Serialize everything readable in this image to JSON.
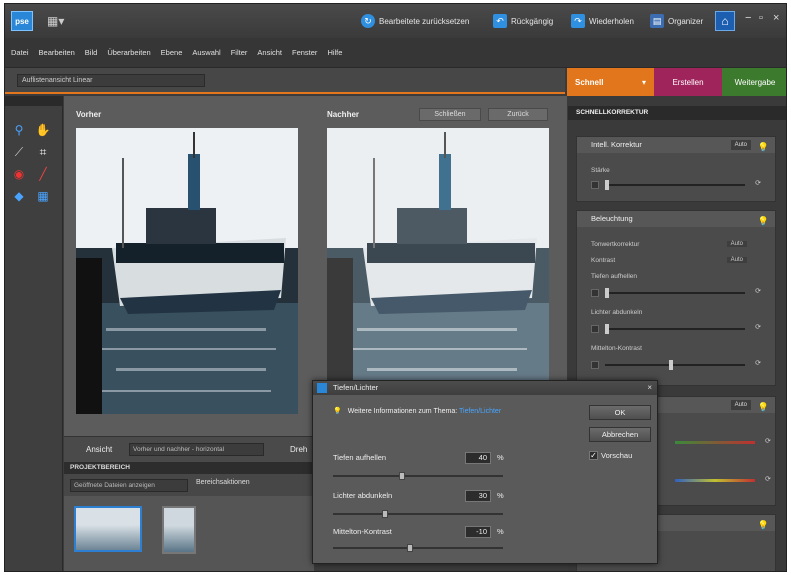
{
  "app": {
    "logo_text": "pse"
  },
  "titlebar": {
    "actions": [
      {
        "label": "Bearbeitete zurücksetzen",
        "icon": "refresh-icon"
      },
      {
        "label": "Rückgängig",
        "icon": "undo-icon"
      },
      {
        "label": "Wiederholen",
        "icon": "redo-icon"
      },
      {
        "label": "Organizer",
        "icon": "organizer-icon"
      }
    ]
  },
  "menu": [
    "Datei",
    "Bearbeiten",
    "Bild",
    "Überarbeiten",
    "Ebene",
    "Auswahl",
    "Filter",
    "Ansicht",
    "Fenster",
    "Hilfe"
  ],
  "options_bar": {
    "preset": "Auflistenansicht   Linear"
  },
  "mode_tabs": [
    {
      "label": "Schnell",
      "color": "#e2761c"
    },
    {
      "label": "Erstellen",
      "color": "#a0245c"
    },
    {
      "label": "Weitergabe",
      "color": "#3c7a2e"
    }
  ],
  "canvas": {
    "before_label": "Vorher",
    "after_label": "Nachher",
    "btn_a": "Schließen",
    "btn_b": "Zurück"
  },
  "viewbar": {
    "label": "Ansicht",
    "value": "Vorher und nachher - horizontal",
    "label2": "Dreh"
  },
  "project_bin": {
    "header": "PROJEKTBEREICH",
    "filter": "Geöffnete Dateien anzeigen",
    "action": "Bereichsaktionen"
  },
  "right_panel": {
    "header": "SCHNELLKORREKTUR",
    "sections": [
      {
        "title": "Intell. Korrektur",
        "auto": "Auto",
        "controls": [
          {
            "label": "Stärke",
            "value": 0.0
          }
        ]
      },
      {
        "title": "Beleuchtung",
        "rows": [
          {
            "label": "Tonwertkorrektur",
            "auto": "Auto"
          },
          {
            "label": "Kontrast",
            "auto": "Auto"
          }
        ],
        "controls": [
          {
            "label": "Tiefen aufhellen",
            "value": 0.0
          },
          {
            "label": "Lichter abdunkeln",
            "value": 0.0
          },
          {
            "label": "Mittelton-Kontrast",
            "value": 0.47
          }
        ]
      },
      {
        "title": "",
        "auto": "Auto"
      },
      {
        "title": ""
      }
    ]
  },
  "dialog": {
    "title": "Tiefen/Lichter",
    "info_text": "Weitere Informationen zum Thema: ",
    "info_link": "Tiefen/Lichter",
    "ok": "OK",
    "cancel": "Abbrechen",
    "preview": "Vorschau",
    "preview_checked": true,
    "fields": [
      {
        "label": "Tiefen aufhellen",
        "value": "40",
        "unit": "%",
        "level": 0.4
      },
      {
        "label": "Lichter abdunkeln",
        "value": "30",
        "unit": "%",
        "level": 0.3
      },
      {
        "label": "Mittelton-Kontrast",
        "value": "-10",
        "unit": "%",
        "level": 0.45
      }
    ]
  }
}
